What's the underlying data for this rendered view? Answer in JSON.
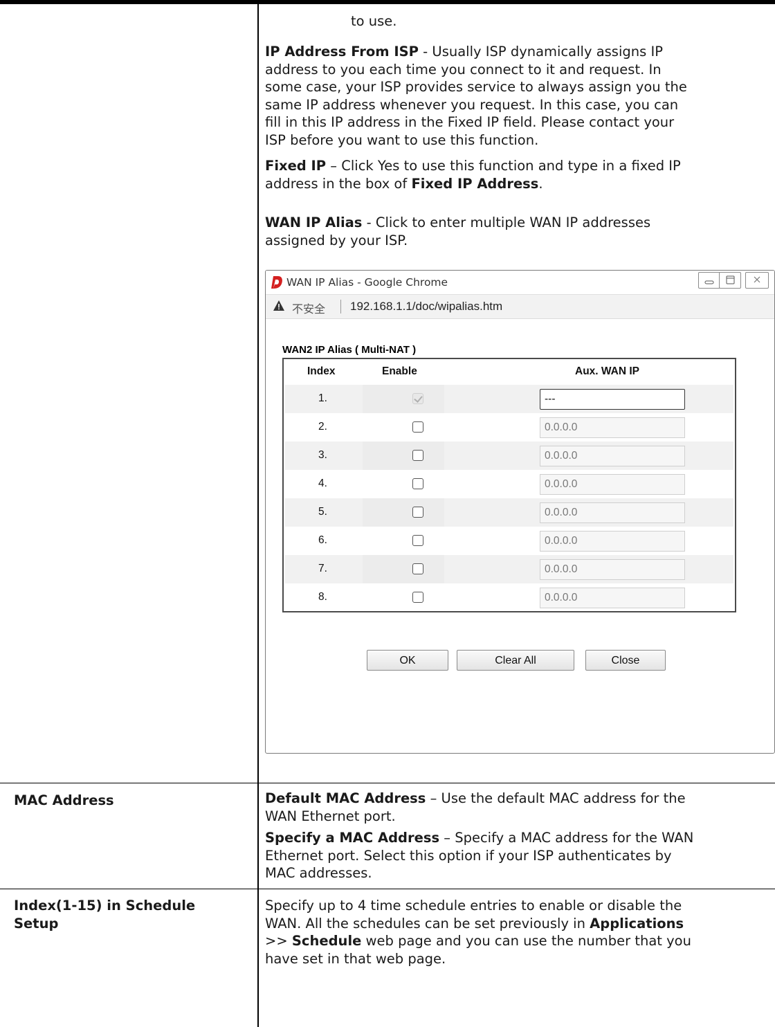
{
  "top_cont": {
    "to_use": "to use.",
    "ip_from_isp": {
      "term": "IP Address From ISP",
      "lines": [
        " - Usually ISP dynamically assigns IP",
        "address to you each time you connect to it and request. In",
        "some case, your ISP provides service to always assign you the",
        "same IP address whenever you request. In this case, you can",
        "fill in this IP address in the Fixed IP field. Please contact your",
        "ISP before you want to use this function."
      ]
    },
    "fixed_ip": {
      "term": "Fixed IP",
      "line1": " – Click Yes to use this function and type in a fixed IP",
      "line2_pre": "address in the box of ",
      "line2_term": "Fixed IP Address",
      "line2_post": "."
    },
    "wan_ip_alias": {
      "term": "WAN IP Alias",
      "line1": " - Click to enter multiple WAN IP addresses",
      "line2": "assigned by your ISP."
    }
  },
  "popup": {
    "window_title": "WAN IP Alias - Google Chrome",
    "not_secure": "不安全",
    "url": "192.168.1.1/doc/wipalias.htm",
    "table_title": "WAN2  IP Alias ( Multi-NAT )",
    "headers": {
      "index": "Index",
      "enable": "Enable",
      "aux_ip": "Aux. WAN IP"
    },
    "rows": [
      {
        "index": "1.",
        "enabled": true,
        "disabled_checkbox": true,
        "ip": "---"
      },
      {
        "index": "2.",
        "enabled": false,
        "ip": "0.0.0.0"
      },
      {
        "index": "3.",
        "enabled": false,
        "ip": "0.0.0.0"
      },
      {
        "index": "4.",
        "enabled": false,
        "ip": "0.0.0.0"
      },
      {
        "index": "5.",
        "enabled": false,
        "ip": "0.0.0.0"
      },
      {
        "index": "6.",
        "enabled": false,
        "ip": "0.0.0.0"
      },
      {
        "index": "7.",
        "enabled": false,
        "ip": "0.0.0.0"
      },
      {
        "index": "8.",
        "enabled": false,
        "ip": "0.0.0.0"
      }
    ],
    "buttons": {
      "ok": "OK",
      "clear_all": "Clear All",
      "close": "Close"
    },
    "colors": {
      "logo": "#d42020",
      "warning": "#333333"
    }
  },
  "mac_row": {
    "label": "MAC Address",
    "default_term": "Default MAC Address",
    "default_l1": " – Use the default MAC address for the",
    "default_l2": "WAN Ethernet port.",
    "specify_term": "Specify a MAC Address",
    "specify_l1": " – Specify a MAC address for the WAN",
    "specify_l2": "Ethernet port. Select this option if your ISP authenticates by",
    "specify_l3": "MAC addresses."
  },
  "schedule_row": {
    "label_l1": "Index(1-15) in Schedule",
    "label_l2": "Setup",
    "l1": "Specify up to 4 time schedule entries to enable or disable the",
    "l2_pre": "WAN. All the schedules can be set previously in ",
    "l2_term": "Applications",
    "l3_pre": ">> ",
    "l3_term": "Schedule",
    "l3_post": " web page and you can use the number that you",
    "l4": "have set in that web page."
  }
}
